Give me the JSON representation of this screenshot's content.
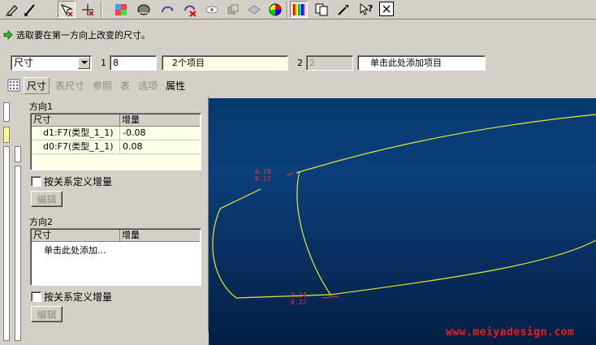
{
  "toolbar": {
    "icons": [
      "edit-pencil-icon",
      "edit-line-icon",
      "move-select-icon",
      "move-arrows-icon",
      "shading-icon",
      "model-color-icon",
      "spin-icon",
      "delete-view-icon",
      "eye-icon",
      "layer-icon",
      "display-icon",
      "color-wheel-icon",
      "palette-icon",
      "copy-icon",
      "tool-icon",
      "whats-this-icon",
      "close-icon"
    ]
  },
  "prompt": {
    "text": "选取要在第一方向上改变的尺寸。"
  },
  "selector": {
    "type_value": "尺寸",
    "label_1": "1",
    "count_1": "8",
    "items_1": "2个项目",
    "label_2": "2",
    "count_2": "2",
    "add_item": "单击此处添加项目"
  },
  "tabs": [
    {
      "label": "尺寸",
      "active": true
    },
    {
      "label": "表尺寸",
      "active": false
    },
    {
      "label": "参照",
      "active": false
    },
    {
      "label": "表",
      "active": false
    },
    {
      "label": "选项",
      "active": false
    },
    {
      "label": "属性",
      "active": true
    }
  ],
  "panel": {
    "direction1": {
      "title": "方向1",
      "col_dimension": "尺寸",
      "col_increment": "增量",
      "rows": [
        {
          "dimension": "d1:F7(类型_1_1)",
          "increment": "-0.08"
        },
        {
          "dimension": "d0:F7(类型_1_1)",
          "increment": "0.08"
        }
      ],
      "relation_checkbox": "按关系定义增量",
      "edit_button": "编辑"
    },
    "direction2": {
      "title": "方向2",
      "col_dimension": "尺寸",
      "col_increment": "增量",
      "add_hint": "单击此处添加...",
      "relation_checkbox": "按关系定义增量",
      "edit_button": "编辑"
    }
  },
  "graphics": {
    "dim_top_1": "0.19",
    "dim_top_2": "0.17",
    "dim_bottom_1": "0.24",
    "dim_bottom_2": "0.22",
    "watermark": "www.meiyadesign.com",
    "curve_color": "#e8e830",
    "dim_color": "#ff3030"
  }
}
